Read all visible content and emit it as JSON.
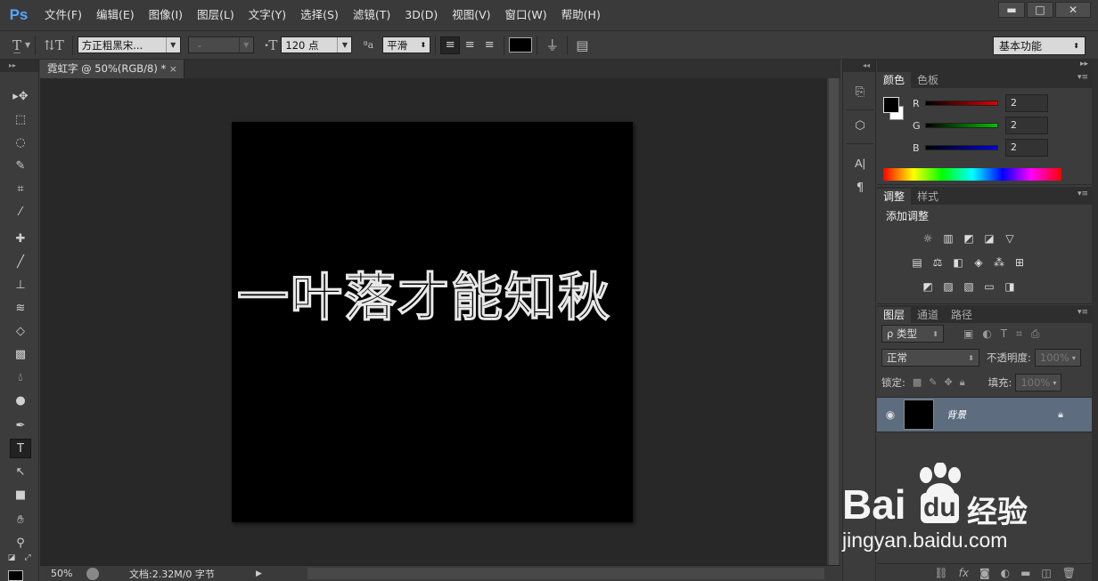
{
  "app": {
    "logo": "Ps",
    "menu": [
      "文件(F)",
      "编辑(E)",
      "图像(I)",
      "图层(L)",
      "文字(Y)",
      "选择(S)",
      "滤镜(T)",
      "3D(D)",
      "视图(V)",
      "窗口(W)",
      "帮助(H)"
    ],
    "window_controls": [
      "minimize",
      "maximize",
      "close"
    ]
  },
  "options": {
    "font_family": "方正粗黑宋...",
    "font_style": "-",
    "font_size": "120 点",
    "aa_label": "ªa",
    "antialias": "平滑",
    "text_color": "#000000",
    "workspace": "基本功能"
  },
  "document": {
    "tab_title": "霓虹字 @ 50%(RGB/8) *",
    "canvas_text": "一叶落才能知秋",
    "zoom": "50%",
    "doc_info": "文档:2.32M/0 字节"
  },
  "panels": {
    "color": {
      "tabs": [
        "颜色",
        "色板"
      ],
      "channels": [
        {
          "label": "R",
          "value": "2",
          "color": "#e00000"
        },
        {
          "label": "G",
          "value": "2",
          "color": "#00c000"
        },
        {
          "label": "B",
          "value": "2",
          "color": "#0000e0"
        }
      ]
    },
    "adjustments": {
      "tabs": [
        "调整",
        "样式"
      ],
      "title": "添加调整"
    },
    "layers": {
      "tabs": [
        "图层",
        "通道",
        "路径"
      ],
      "filter": "ρ 类型",
      "blend_mode": "正常",
      "opacity_label": "不透明度:",
      "opacity_value": "100%",
      "lock_label": "锁定:",
      "fill_label": "填充:",
      "fill_value": "100%",
      "layer_name": "背景"
    }
  },
  "watermark": {
    "brand": "Bai",
    "brand2": "du",
    "brand_cn": "经验",
    "url": "jingyan.baidu.com"
  }
}
